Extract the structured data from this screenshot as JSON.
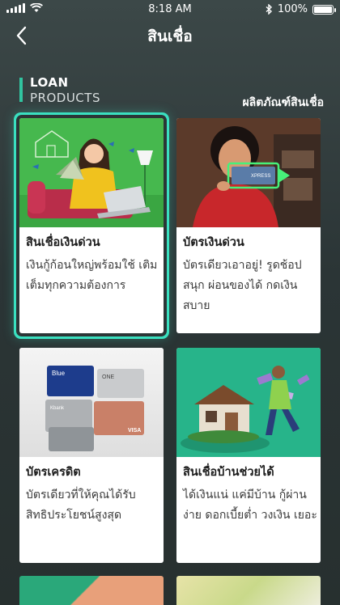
{
  "status_bar": {
    "time": "8:18 AM",
    "battery": "100%",
    "battery_level": 1.0
  },
  "header": {
    "title": "สินเชื่อ"
  },
  "section": {
    "title": "LOAN",
    "subtitle": "PRODUCTS",
    "link_label": "ผลิตภัณฑ์สินเชื่อ"
  },
  "cards": [
    {
      "title": "สินเชื่อเงินด่วน",
      "desc": "เงินกู้ก้อนใหญ่พร้อมใช้ เติมเต็มทุกความต้องการ"
    },
    {
      "title": "บัตรเงินด่วน",
      "desc": "บัตรเดียวเอาอยู่! รูดช้อป สนุก ผ่อนของได้ กดเงิน สบาย"
    },
    {
      "title": "บัตรเครดิต",
      "desc": "บัตรเดียวที่ให้คุณได้รับ สิทธิประโยชน์สูงสุด"
    },
    {
      "title": "สินเชื่อบ้านช่วยได้",
      "desc": "ได้เงินแน่ แค่มีบ้าน กู้ผ่าน ง่าย ดอกเบี้ยต่ำ วงเงิน เยอะ"
    }
  ],
  "card_art_text": {
    "blue_card": "Blue",
    "one_card": "ONE",
    "kbank": "Kbank",
    "visa": "VISA",
    "xpress": "XPRESS"
  },
  "colors": {
    "accent": "#31c4a0",
    "selected_glow": "#3ae0c0"
  }
}
